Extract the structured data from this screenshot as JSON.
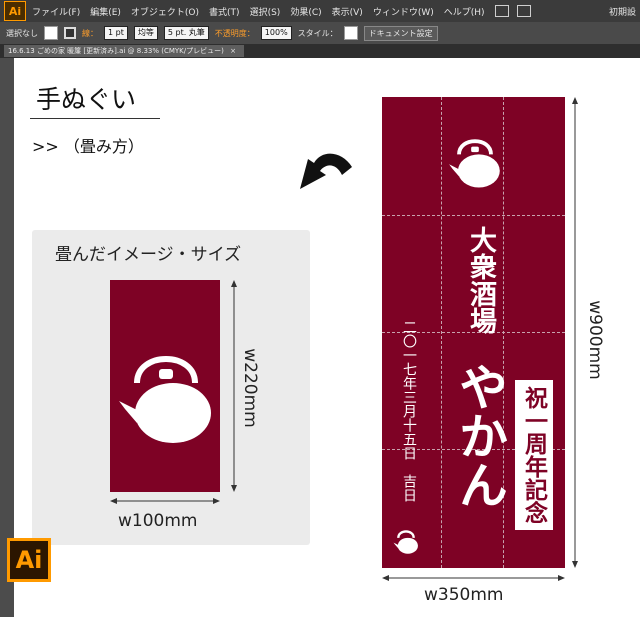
{
  "menubar": {
    "logo": "Ai",
    "items": [
      "ファイル(F)",
      "編集(E)",
      "オブジェクト(O)",
      "書式(T)",
      "選択(S)",
      "効果(C)",
      "表示(V)",
      "ウィンドウ(W)",
      "ヘルプ(H)"
    ],
    "workspace": "初期設"
  },
  "controlbar": {
    "selection": "選択なし",
    "stroke_label": "線：",
    "stroke_value": "1 pt",
    "profile": "均等",
    "brush": "5 pt. 丸筆",
    "opacity_label": "不透明度：",
    "opacity_value": "100%",
    "style_label": "スタイル：",
    "doc_setup": "ドキュメント設定"
  },
  "tab": {
    "label": "16.6.13  ごめの家  暖簾 [更新済み].ai @ 8.33% (CMYK/プレビュー)",
    "close": "×"
  },
  "artwork": {
    "title": "手ぬぐい",
    "subtitle": ">> （畳み方）",
    "folded_label": "畳んだイメージ・サイズ",
    "folded_height": "w220mm",
    "folded_width": "w100mm",
    "towel_text_main": "大衆酒場",
    "towel_text_name": "やかん",
    "towel_text_date": "二〇一七年三月十五日　吉日",
    "towel_badge": "祝一周年記念",
    "towel_height": "w900mm",
    "towel_width": "w350mm",
    "ai_badge": "Ai"
  },
  "colors": {
    "towel": "#7e0225",
    "menubar": "#3b3b3b",
    "accent": "#ff9a00"
  },
  "icons": {
    "kettle": "kettle-icon",
    "curved_arrow": "curved-arrow-icon"
  }
}
